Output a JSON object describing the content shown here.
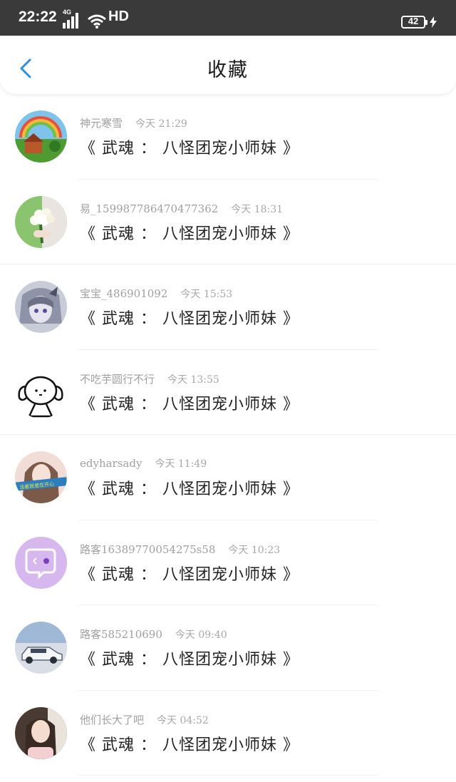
{
  "status_bar": {
    "time": "22:22",
    "network": "4G",
    "hd": "HD",
    "battery": "42"
  },
  "header": {
    "title": "收藏"
  },
  "favorites": [
    {
      "user": "神元寒雪",
      "time": "今天 21:29",
      "title": "《 武魂 ： 八怪团宠小师妹 》",
      "avatar_icon": "rainbow-landscape-avatar"
    },
    {
      "user": "易_15998778647047736​2",
      "time": "今天 18:31",
      "title": "《 武魂 ： 八怪团宠小师妹 》",
      "avatar_icon": "flower-bouquet-avatar"
    },
    {
      "user": "宝宝_486901092",
      "time": "今天 15:53",
      "title": "《 武魂 ： 八怪团宠小师妹 》",
      "avatar_icon": "anime-girl-avatar"
    },
    {
      "user": "不吃芋圆行不行",
      "time": "今天 13:55",
      "title": "《 武魂 ： 八怪团宠小师妹 》",
      "avatar_icon": "doodle-face-avatar"
    },
    {
      "user": "edyharsady",
      "time": "今天 11:49",
      "title": "《 武魂 ： 八怪团宠小师妹 》",
      "avatar_icon": "girl-photo-avatar"
    },
    {
      "user": "路客16389770054275s58",
      "time": "今天 10:23",
      "title": "《 武魂 ： 八怪团宠小师妹 》",
      "avatar_icon": "chat-bubble-avatar"
    },
    {
      "user": "路客585210690",
      "time": "今天 09:40",
      "title": "《 武魂 ： 八怪团宠小师妹 》",
      "avatar_icon": "car-avatar"
    },
    {
      "user": "他们长大了吧",
      "time": "今天 04:52",
      "title": "《 武魂 ： 八怪团宠小师妹 》",
      "avatar_icon": "woman-photo-avatar"
    }
  ]
}
